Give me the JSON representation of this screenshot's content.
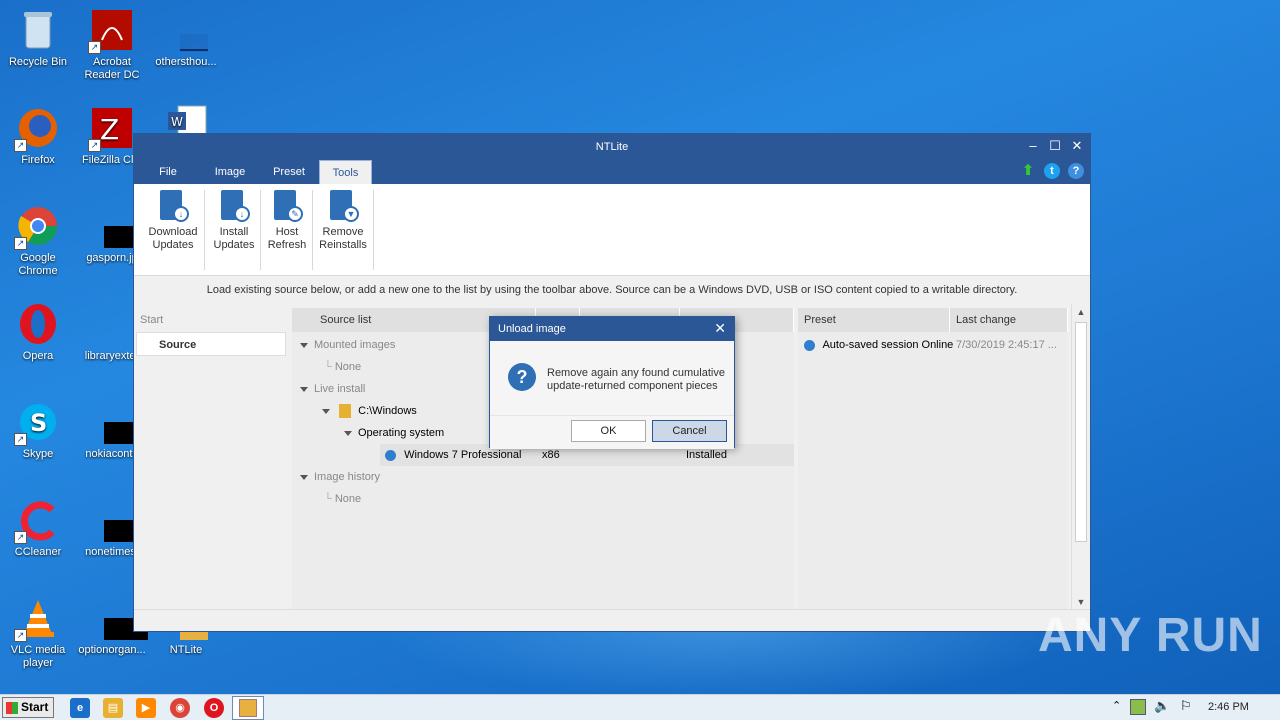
{
  "desktop": {
    "icons": [
      {
        "label": "Recycle Bin"
      },
      {
        "label": "Acrobat Reader DC"
      },
      {
        "label": "othersthou..."
      },
      {
        "label": "Firefox"
      },
      {
        "label": "FileZilla Clie"
      },
      {
        "label": "Google Chrome"
      },
      {
        "label": "gasporn.jp"
      },
      {
        "label": "Opera"
      },
      {
        "label": "libraryexter"
      },
      {
        "label": "Skype"
      },
      {
        "label": "nokiaconta"
      },
      {
        "label": "CCleaner"
      },
      {
        "label": "nonetimes."
      },
      {
        "label": "VLC media player"
      },
      {
        "label": "optionorgan..."
      },
      {
        "label": "NTLite"
      }
    ]
  },
  "window": {
    "title": "NTLite",
    "menu": [
      "File",
      "Image",
      "Preset",
      "Tools"
    ],
    "active_tab": "Tools",
    "ribbon": [
      {
        "label_line1": "Download",
        "label_line2": "Updates"
      },
      {
        "label_line1": "Install",
        "label_line2": "Updates"
      },
      {
        "label_line1": "Host",
        "label_line2": "Refresh"
      },
      {
        "label_line1": "Remove",
        "label_line2": "Reinstalls"
      }
    ],
    "hint": "Load existing source below, or add a new one to the list by using the toolbar above. Source can be a Windows DVD, USB or ISO content copied to a writable directory.",
    "left_panel": {
      "section_label": "Start",
      "item": "Source"
    },
    "source_list": {
      "header": "Source list",
      "mounted_images": "Mounted images",
      "mounted_none": "None",
      "live_install": "Live install",
      "path": "C:\\Windows",
      "operating_system": "Operating system",
      "os_name": "Windows 7 Professional",
      "arch": "x86",
      "status": "Installed",
      "image_history": "Image history",
      "history_none": "None"
    },
    "preset_panel": {
      "col_preset": "Preset",
      "col_last_change": "Last change",
      "row_preset": "Auto-saved session Online",
      "row_last_change": "7/30/2019 2:45:17 ..."
    }
  },
  "dialog": {
    "title": "Unload image",
    "message_line1": "Remove again any found cumulative",
    "message_line2": "update-returned component pieces",
    "ok": "OK",
    "cancel": "Cancel"
  },
  "taskbar": {
    "start": "Start",
    "time": "2:46 PM"
  },
  "watermark": "ANY RUN"
}
